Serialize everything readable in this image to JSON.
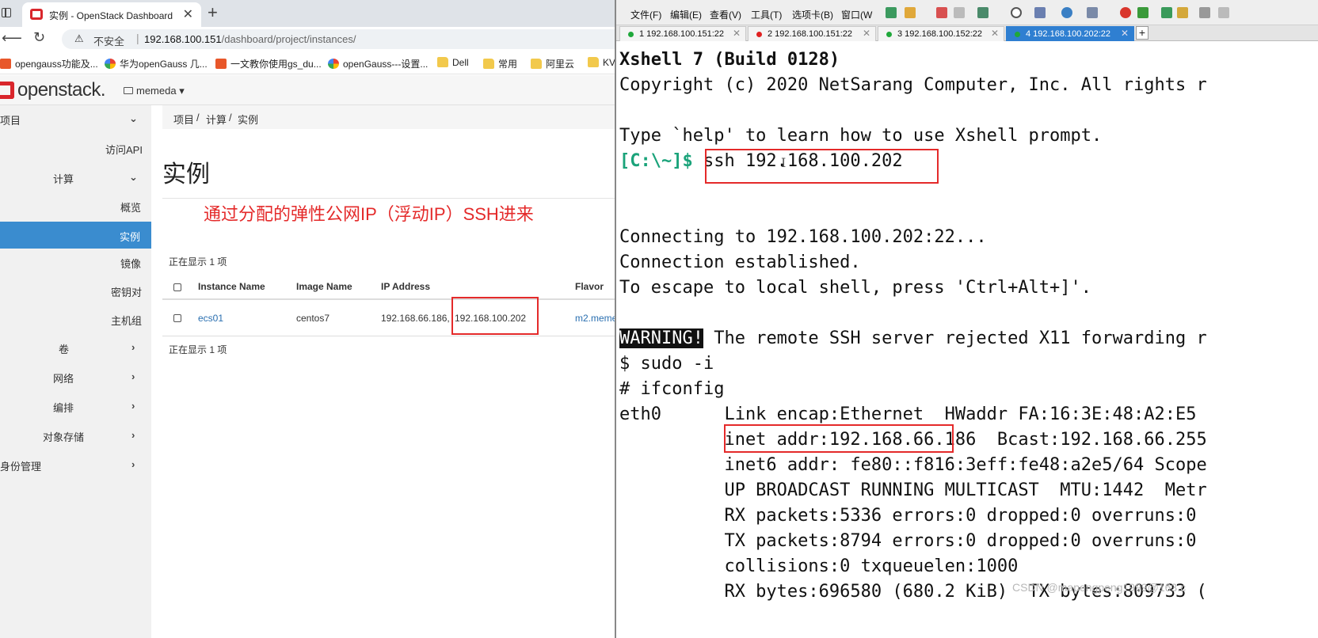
{
  "browser": {
    "tab_title": "实例 - OpenStack Dashboard",
    "tab_close": "✕",
    "new_tab": "+",
    "insecure_label": "不安全",
    "url_host": "192.168.100.151",
    "url_path": "/dashboard/project/instances/",
    "bookmarks": [
      "opengauss功能及...",
      "华为openGauss 几...",
      "一文教你使用gs_du...",
      "openGauss---设置...",
      "Dell",
      "常用",
      "阿里云",
      "KV"
    ]
  },
  "openstack": {
    "logo": "openstack.",
    "project": "memeda",
    "sidebar": {
      "project": "项目",
      "api_access": "访问API",
      "compute": "计算",
      "overview": "概览",
      "instances": "实例",
      "images": "镜像",
      "keypairs": "密钥对",
      "server_groups": "主机组",
      "volumes": "卷",
      "network": "网络",
      "orchestration": "编排",
      "object_store": "对象存储",
      "identity": "身份管理"
    },
    "breadcrumb": [
      "项目",
      "/",
      "计算",
      "/",
      "实例"
    ],
    "page_title": "实例",
    "annotation": "通过分配的弹性公网IP（浮动IP）SSH进来",
    "showing_top": "正在显示 1 项",
    "showing_bottom": "正在显示 1 项",
    "columns": [
      "Instance Name",
      "Image Name",
      "IP Address",
      "Flavor"
    ],
    "row": {
      "name": "ecs01",
      "image": "centos7",
      "ip_private": "192.168.66.186,",
      "ip_floating": "192.168.100.202",
      "flavor": "m2.meme"
    }
  },
  "xshell": {
    "menus": [
      "文件(F)",
      "编辑(E)",
      "查看(V)",
      "工具(T)",
      "选项卡(B)",
      "窗口(W"
    ],
    "tabs": [
      {
        "label": "1 192.168.100.151:22",
        "dot": "#1fa83a"
      },
      {
        "label": "2 192.168.100.151:22",
        "dot": "#e02020"
      },
      {
        "label": "3 192.168.100.152:22",
        "dot": "#1fa83a"
      },
      {
        "label": "4 192.168.100.202:22",
        "dot": "#1fa83a"
      }
    ],
    "tab_close": "✕",
    "add_tab": "+",
    "terminal": {
      "l1": "Xshell 7 (Build 0128)",
      "l2": "Copyright (c) 2020 NetSarang Computer, Inc. All rights r",
      "l3": "Type `help' to learn how to use Xshell prompt.",
      "prompt": "[C:\\~]$",
      "cmd": " ssh 192.168.100.202",
      "l5": "Connecting to 192.168.100.202:22...",
      "l6": "Connection established.",
      "l7": "To escape to local shell, press 'Ctrl+Alt+]'.",
      "warning_tag": "WARNING!",
      "warning_rest": " The remote SSH server rejected X11 forwarding r",
      "l9": "$ sudo -i",
      "l10": "# ifconfig",
      "l11": "eth0      Link encap:Ethernet  HWaddr FA:16:3E:48:A2:E5",
      "l12a": "          inet addr:192.168.66.186",
      "l12b": "  Bcast:192.168.66.255",
      "l13": "          inet6 addr: fe80::f816:3eff:fe48:a2e5/64 Scope",
      "l14": "          UP BROADCAST RUNNING MULTICAST  MTU:1442  Metr",
      "l15": "          RX packets:5336 errors:0 dropped:0 overruns:0",
      "l16": "          TX packets:8794 errors:0 dropped:0 overruns:0",
      "l17": "          collisions:0 txqueuelen:1000",
      "l18": "          RX bytes:696580 (680.2 KiB)  TX bytes:809733 (",
      "watermark": "CSDN @mapengpeng1999@163.c"
    }
  },
  "colors": {
    "accent": "#3a8ccf",
    "annotation": "#e42a2a",
    "prompt": "#1aa37a",
    "brand": "#d9262c"
  }
}
